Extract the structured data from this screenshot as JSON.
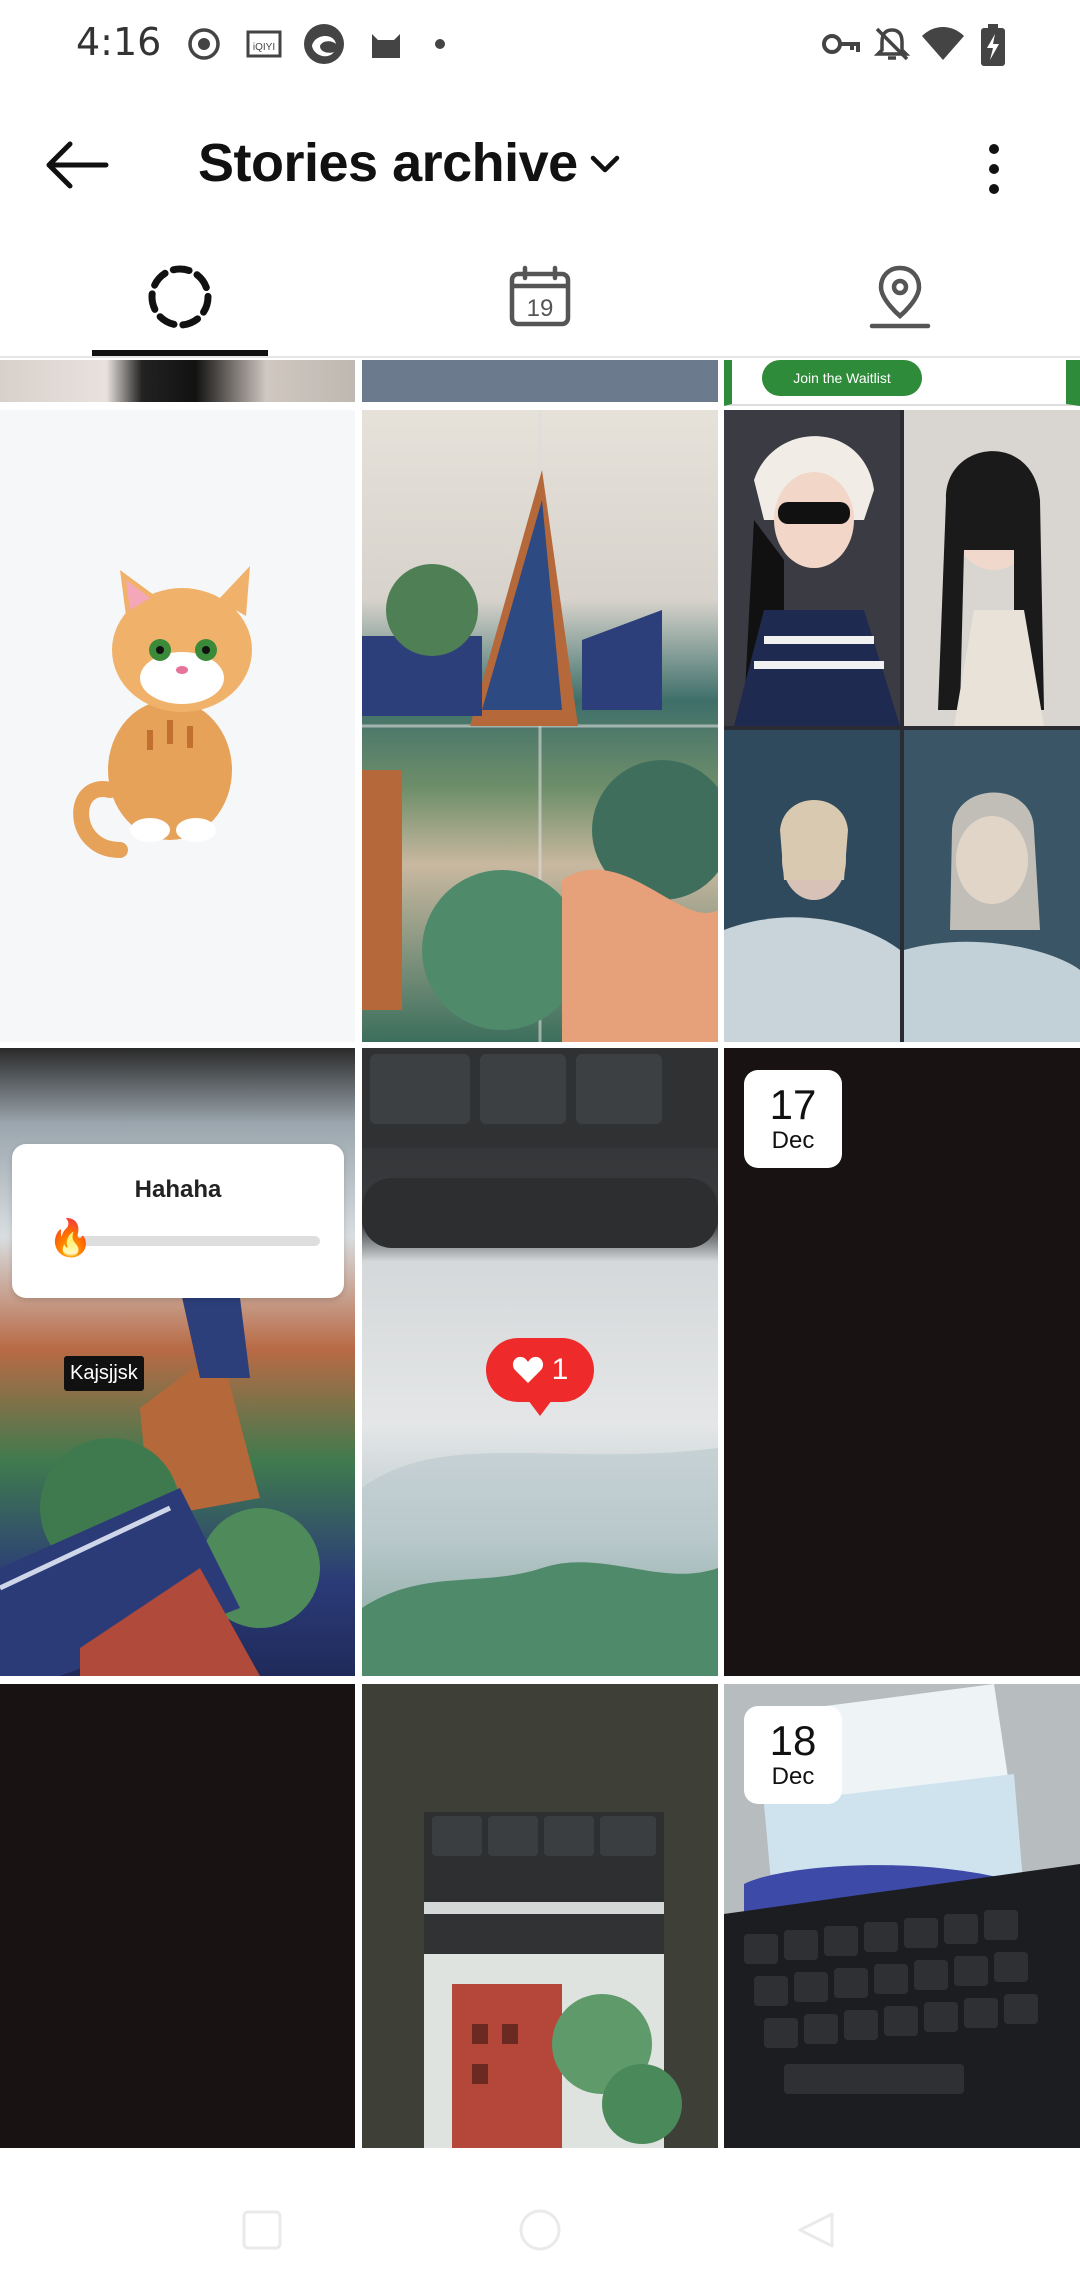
{
  "status_bar": {
    "time": "4:16",
    "left_icons": [
      "record-icon",
      "iqiyi-icon",
      "edge-icon",
      "cat-app-icon",
      "dot-icon"
    ],
    "right_icons": [
      "vpn-key-icon",
      "bell-off-icon",
      "wifi-icon",
      "battery-charging-icon"
    ],
    "iqiyi_label": "iQIYI"
  },
  "header": {
    "back_icon": "arrow-left-icon",
    "title": "Stories archive",
    "title_chevron": "chevron-down-icon",
    "more_icon": "more-vertical-icon"
  },
  "tabs": [
    {
      "name": "stories",
      "icon": "story-ring-icon",
      "active": true
    },
    {
      "name": "calendar",
      "icon": "calendar-icon",
      "calendar_day": "19",
      "active": false
    },
    {
      "name": "map",
      "icon": "location-pin-icon",
      "active": false
    }
  ],
  "grid": {
    "top_row_partial": {
      "waitlist_label": "Join the Waitlist"
    },
    "cells": [
      {
        "kind": "cat-sticker"
      },
      {
        "kind": "painting-collage"
      },
      {
        "kind": "photo-collage"
      },
      {
        "kind": "poll",
        "poll_title": "Hahaha",
        "poll_emoji": "🔥",
        "name_tag": "Kajsjjsk",
        "poll_value": 0.06
      },
      {
        "kind": "keyboard-like",
        "like_count": "1"
      },
      {
        "kind": "dark",
        "date_day": "17",
        "date_month": "Dec"
      },
      {
        "kind": "dark"
      },
      {
        "kind": "keyboard-frame"
      },
      {
        "kind": "tissue-keyboard",
        "date_day": "18",
        "date_month": "Dec"
      }
    ]
  },
  "navbar": {
    "buttons": [
      "square-recent-icon",
      "circle-home-icon",
      "triangle-back-icon"
    ]
  }
}
